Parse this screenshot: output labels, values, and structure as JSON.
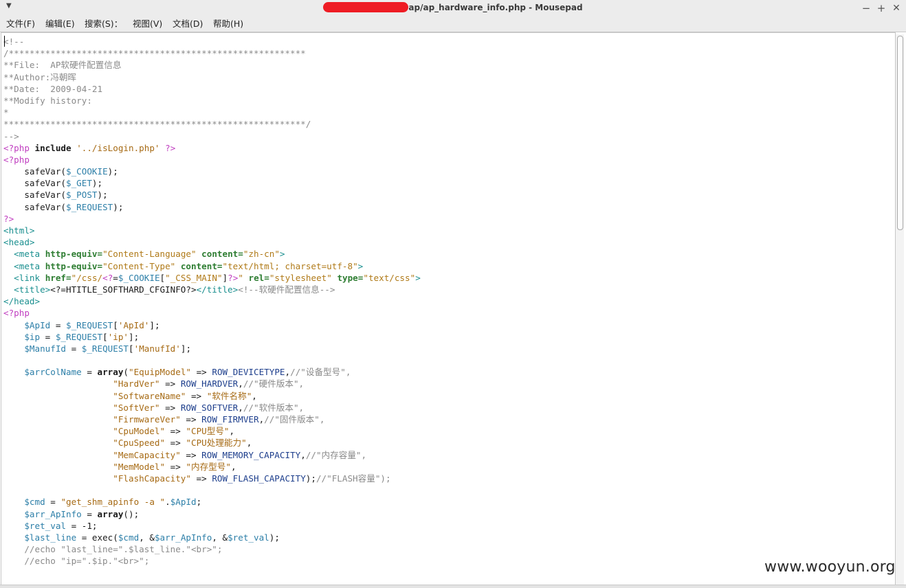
{
  "window": {
    "title": "ap/ap_hardware_info.php - Mousepad"
  },
  "menubar": [
    "文件(F)",
    "编辑(E)",
    "搜索(S)：",
    "视图(V)",
    "文档(D)",
    "帮助(H)"
  ],
  "watermark": "www.wooyun.org",
  "colors": {
    "comment": "#8a8a8a",
    "php_tag": "#c03ec0",
    "variable": "#2d7fa8",
    "string": "#a66a14",
    "html_tag": "#1a8f8f",
    "attribute": "#2e7d32",
    "constant": "#1d3e8c",
    "redaction": "#ee1c24"
  },
  "editor": {
    "lines": [
      [
        [
          "cm",
          "<!--"
        ]
      ],
      [
        [
          "cm",
          "/*********************************************************"
        ]
      ],
      [
        [
          "cm",
          "**File:  AP软硬件配置信息"
        ]
      ],
      [
        [
          "cm",
          "**Author:冯朝晖"
        ]
      ],
      [
        [
          "cm",
          "**Date:  2009-04-21"
        ]
      ],
      [
        [
          "cm",
          "**Modify history:"
        ]
      ],
      [
        [
          "cm",
          "*"
        ]
      ],
      [
        [
          "cm",
          "**********************************************************/"
        ]
      ],
      [
        [
          "cm",
          "-->"
        ]
      ],
      [
        [
          "kw",
          "<?php"
        ],
        [
          "pl",
          " "
        ],
        [
          "fn",
          "include"
        ],
        [
          "pl",
          " "
        ],
        [
          "st",
          "'../isLogin.php'"
        ],
        [
          "pl",
          " "
        ],
        [
          "kw",
          "?>"
        ]
      ],
      [
        [
          "kw",
          "<?php"
        ]
      ],
      [
        [
          "pl",
          "    safeVar("
        ],
        [
          "vr",
          "$_COOKIE"
        ],
        [
          "pl",
          ");"
        ]
      ],
      [
        [
          "pl",
          "    safeVar("
        ],
        [
          "vr",
          "$_GET"
        ],
        [
          "pl",
          ");"
        ]
      ],
      [
        [
          "pl",
          "    safeVar("
        ],
        [
          "vr",
          "$_POST"
        ],
        [
          "pl",
          ");"
        ]
      ],
      [
        [
          "pl",
          "    safeVar("
        ],
        [
          "vr",
          "$_REQUEST"
        ],
        [
          "pl",
          ");"
        ]
      ],
      [
        [
          "kw",
          "?>"
        ]
      ],
      [
        [
          "tg",
          "<html>"
        ]
      ],
      [
        [
          "tg",
          "<head>"
        ]
      ],
      [
        [
          "pl",
          "  "
        ],
        [
          "tg",
          "<meta"
        ],
        [
          "pl",
          " "
        ],
        [
          "at",
          "http-equiv="
        ],
        [
          "av",
          "\"Content-Language\""
        ],
        [
          "pl",
          " "
        ],
        [
          "at",
          "content="
        ],
        [
          "av",
          "\"zh-cn\""
        ],
        [
          "tg",
          ">"
        ]
      ],
      [
        [
          "pl",
          "  "
        ],
        [
          "tg",
          "<meta"
        ],
        [
          "pl",
          " "
        ],
        [
          "at",
          "http-equiv="
        ],
        [
          "av",
          "\"Content-Type\""
        ],
        [
          "pl",
          " "
        ],
        [
          "at",
          "content="
        ],
        [
          "av",
          "\"text/html; charset=utf-8\""
        ],
        [
          "tg",
          ">"
        ]
      ],
      [
        [
          "pl",
          "  "
        ],
        [
          "tg",
          "<link"
        ],
        [
          "pl",
          " "
        ],
        [
          "at",
          "href="
        ],
        [
          "av",
          "\"/css/"
        ],
        [
          "kw",
          "<?"
        ],
        [
          "pl",
          "="
        ],
        [
          "vr",
          "$_COOKIE"
        ],
        [
          "pl",
          "["
        ],
        [
          "av",
          "\"_CSS_MAIN\""
        ],
        [
          "pl",
          "]"
        ],
        [
          "kw",
          "?>"
        ],
        [
          "av",
          "\""
        ],
        [
          "pl",
          " "
        ],
        [
          "at",
          "rel="
        ],
        [
          "av",
          "\"stylesheet\""
        ],
        [
          "pl",
          " "
        ],
        [
          "at",
          "type="
        ],
        [
          "av",
          "\"text/css\""
        ],
        [
          "tg",
          ">"
        ]
      ],
      [
        [
          "pl",
          "  "
        ],
        [
          "tg",
          "<title>"
        ],
        [
          "pl",
          "<?=HTITLE_SOFTHARD_CFGINFO?>"
        ],
        [
          "tg",
          "</title>"
        ],
        [
          "cm",
          "<!--软硬件配置信息-->"
        ]
      ],
      [
        [
          "tg",
          "</head>"
        ]
      ],
      [
        [
          "kw",
          "<?php"
        ]
      ],
      [
        [
          "pl",
          "    "
        ],
        [
          "vr",
          "$ApId"
        ],
        [
          "pl",
          " = "
        ],
        [
          "vr",
          "$_REQUEST"
        ],
        [
          "pl",
          "["
        ],
        [
          "st",
          "'ApId'"
        ],
        [
          "pl",
          "];"
        ]
      ],
      [
        [
          "pl",
          "    "
        ],
        [
          "vr",
          "$ip"
        ],
        [
          "pl",
          " = "
        ],
        [
          "vr",
          "$_REQUEST"
        ],
        [
          "pl",
          "["
        ],
        [
          "st",
          "'ip'"
        ],
        [
          "pl",
          "];"
        ]
      ],
      [
        [
          "pl",
          "    "
        ],
        [
          "vr",
          "$ManufId"
        ],
        [
          "pl",
          " = "
        ],
        [
          "vr",
          "$_REQUEST"
        ],
        [
          "pl",
          "["
        ],
        [
          "st",
          "'ManufId'"
        ],
        [
          "pl",
          "];"
        ]
      ],
      [
        [
          "pl",
          ""
        ]
      ],
      [
        [
          "pl",
          "    "
        ],
        [
          "vr",
          "$arrColName"
        ],
        [
          "pl",
          " = "
        ],
        [
          "fn",
          "array"
        ],
        [
          "pl",
          "("
        ],
        [
          "st",
          "\"EquipModel\""
        ],
        [
          "pl",
          " => "
        ],
        [
          "ct",
          "ROW_DEVICETYPE"
        ],
        [
          "pl",
          ","
        ],
        [
          "cm",
          "//\"设备型号\","
        ]
      ],
      [
        [
          "pl",
          "                     "
        ],
        [
          "st",
          "\"HardVer\""
        ],
        [
          "pl",
          " => "
        ],
        [
          "ct",
          "ROW_HARDVER"
        ],
        [
          "pl",
          ","
        ],
        [
          "cm",
          "//\"硬件版本\","
        ]
      ],
      [
        [
          "pl",
          "                     "
        ],
        [
          "st",
          "\"SoftwareName\""
        ],
        [
          "pl",
          " => "
        ],
        [
          "st",
          "\"软件名称\""
        ],
        [
          "pl",
          ","
        ]
      ],
      [
        [
          "pl",
          "                     "
        ],
        [
          "st",
          "\"SoftVer\""
        ],
        [
          "pl",
          " => "
        ],
        [
          "ct",
          "ROW_SOFTVER"
        ],
        [
          "pl",
          ","
        ],
        [
          "cm",
          "//\"软件版本\","
        ]
      ],
      [
        [
          "pl",
          "                     "
        ],
        [
          "st",
          "\"FirmwareVer\""
        ],
        [
          "pl",
          " => "
        ],
        [
          "ct",
          "ROW_FIRMVER"
        ],
        [
          "pl",
          ","
        ],
        [
          "cm",
          "//\"固件版本\","
        ]
      ],
      [
        [
          "pl",
          "                     "
        ],
        [
          "st",
          "\"CpuModel\""
        ],
        [
          "pl",
          " => "
        ],
        [
          "st",
          "\"CPU型号\""
        ],
        [
          "pl",
          ","
        ]
      ],
      [
        [
          "pl",
          "                     "
        ],
        [
          "st",
          "\"CpuSpeed\""
        ],
        [
          "pl",
          " => "
        ],
        [
          "st",
          "\"CPU处理能力\""
        ],
        [
          "pl",
          ","
        ]
      ],
      [
        [
          "pl",
          "                     "
        ],
        [
          "st",
          "\"MemCapacity\""
        ],
        [
          "pl",
          " => "
        ],
        [
          "ct",
          "ROW_MEMORY_CAPACITY"
        ],
        [
          "pl",
          ","
        ],
        [
          "cm",
          "//\"内存容量\","
        ]
      ],
      [
        [
          "pl",
          "                     "
        ],
        [
          "st",
          "\"MemModel\""
        ],
        [
          "pl",
          " => "
        ],
        [
          "st",
          "\"内存型号\""
        ],
        [
          "pl",
          ","
        ]
      ],
      [
        [
          "pl",
          "                     "
        ],
        [
          "st",
          "\"FlashCapacity\""
        ],
        [
          "pl",
          " => "
        ],
        [
          "ct",
          "ROW_FLASH_CAPACITY"
        ],
        [
          "pl",
          ");"
        ],
        [
          "cm",
          "//\"FLASH容量\");"
        ]
      ],
      [
        [
          "pl",
          ""
        ]
      ],
      [
        [
          "pl",
          "    "
        ],
        [
          "vr",
          "$cmd"
        ],
        [
          "pl",
          " = "
        ],
        [
          "st",
          "\"get_shm_apinfo -a \""
        ],
        [
          "pl",
          "."
        ],
        [
          "vr",
          "$ApId"
        ],
        [
          "pl",
          ";"
        ]
      ],
      [
        [
          "pl",
          "    "
        ],
        [
          "vr",
          "$arr_ApInfo"
        ],
        [
          "pl",
          " = "
        ],
        [
          "fn",
          "array"
        ],
        [
          "pl",
          "();"
        ]
      ],
      [
        [
          "pl",
          "    "
        ],
        [
          "vr",
          "$ret_val"
        ],
        [
          "pl",
          " = -1;"
        ]
      ],
      [
        [
          "pl",
          "    "
        ],
        [
          "vr",
          "$last_line"
        ],
        [
          "pl",
          " = exec("
        ],
        [
          "vr",
          "$cmd"
        ],
        [
          "pl",
          ", &"
        ],
        [
          "vr",
          "$arr_ApInfo"
        ],
        [
          "pl",
          ", &"
        ],
        [
          "vr",
          "$ret_val"
        ],
        [
          "pl",
          ");"
        ]
      ],
      [
        [
          "cm",
          "    //echo \"last_line=\".$last_line.\"<br>\";"
        ]
      ],
      [
        [
          "cm",
          "    //echo \"ip=\".$ip.\"<br>\";"
        ]
      ]
    ]
  }
}
